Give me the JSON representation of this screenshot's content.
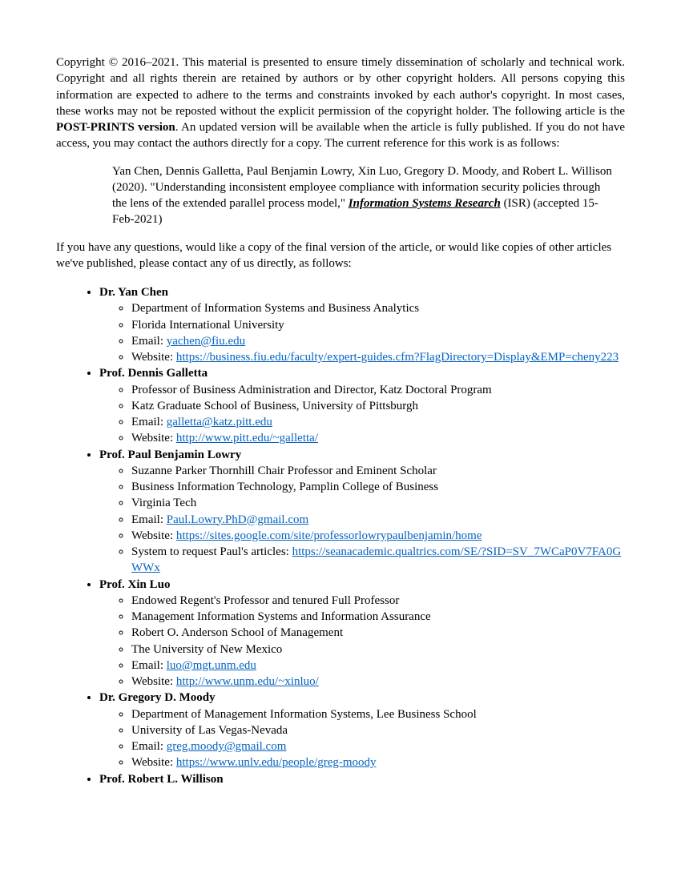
{
  "copyright": {
    "prefix": "Copyright © 2016–2021. This material is presented to ensure timely dissemination of scholarly and technical work. Copyright and all rights therein are retained by authors or by other copyright holders. All persons copying this information are expected to adhere to the terms and constraints invoked by each author's copyright. In most cases, these works may not be reposted without the explicit permission of the copyright holder. The following article is the ",
    "post_prints": "POST-PRINTS version",
    "suffix": ". An updated version will be available when the article is fully published. If you do not have access, you may contact the authors directly for a copy. The current reference for this work is as follows:"
  },
  "citation": {
    "authors_and_title": "Yan Chen, Dennis Galletta, Paul Benjamin Lowry, Xin Luo, Gregory D. Moody, and Robert L. Willison (2020). \"Understanding inconsistent employee compliance with information security policies through the lens of the extended parallel process model,\" ",
    "journal": "Information Systems Research",
    "tail": " (ISR) (accepted 15-Feb-2021)"
  },
  "questions": "If you have any questions, would like a copy of the final version of the article, or would like copies of other articles we've published, please contact any of us directly, as follows:",
  "authors": [
    {
      "name": "Dr. Yan Chen",
      "items": [
        {
          "text": "Department of Information Systems and Business Analytics"
        },
        {
          "text": "Florida International University"
        },
        {
          "label": "Email: ",
          "link": "yachen@fiu.edu"
        },
        {
          "label": "Website: ",
          "link": "https://business.fiu.edu/faculty/expert-guides.cfm?FlagDirectory=Display&EMP=cheny223"
        }
      ]
    },
    {
      "name": "Prof. Dennis Galletta",
      "items": [
        {
          "text": "Professor of Business Administration and Director, Katz Doctoral Program"
        },
        {
          "text": "Katz Graduate School of Business, University of Pittsburgh"
        },
        {
          "label": "Email: ",
          "link": "galletta@katz.pitt.edu"
        },
        {
          "label": "Website: ",
          "link": "http://www.pitt.edu/~galletta/"
        }
      ]
    },
    {
      "name": "Prof. Paul Benjamin Lowry",
      "items": [
        {
          "text": "Suzanne Parker Thornhill Chair Professor and Eminent Scholar"
        },
        {
          "text": "Business Information Technology, Pamplin College of Business"
        },
        {
          "text": "Virginia Tech"
        },
        {
          "label": "Email: ",
          "link": "Paul.Lowry.PhD@gmail.com"
        },
        {
          "label": "Website: ",
          "link": "https://sites.google.com/site/professorlowrypaulbenjamin/home"
        },
        {
          "label": "System to request Paul's articles: ",
          "link": "https://seanacademic.qualtrics.com/SE/?SID=SV_7WCaP0V7FA0GWWx"
        }
      ]
    },
    {
      "name": "Prof. Xin Luo",
      "items": [
        {
          "text": "Endowed Regent's Professor and tenured Full Professor"
        },
        {
          "text": "Management Information Systems and Information Assurance"
        },
        {
          "text": "Robert O. Anderson School of Management"
        },
        {
          "text": "The University of New Mexico"
        },
        {
          "label": "Email: ",
          "link": "luo@mgt.unm.edu"
        },
        {
          "label": "Website: ",
          "link": "http://www.unm.edu/~xinluo/"
        }
      ]
    },
    {
      "name": "Dr. Gregory D. Moody",
      "items": [
        {
          "text": "Department of Management Information Systems, Lee Business School"
        },
        {
          "text": "University of Las Vegas-Nevada"
        },
        {
          "label": "Email: ",
          "link": "greg.moody@gmail.com"
        },
        {
          "label": "Website: ",
          "link": "https://www.unlv.edu/people/greg-moody"
        }
      ]
    },
    {
      "name": "Prof. Robert L. Willison",
      "items": []
    }
  ]
}
